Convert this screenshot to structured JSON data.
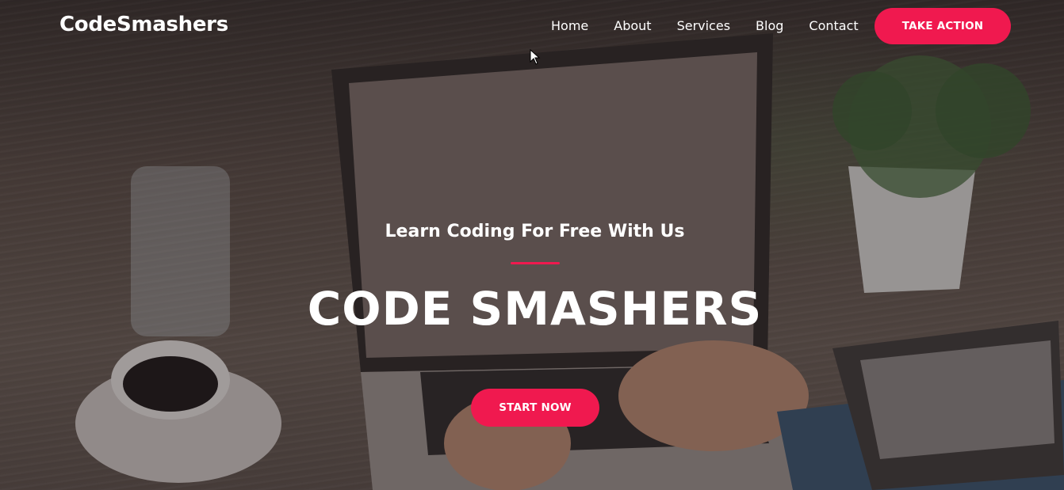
{
  "brand": {
    "name": "CodeSmashers"
  },
  "nav": {
    "items": [
      {
        "label": "Home"
      },
      {
        "label": "About"
      },
      {
        "label": "Services"
      },
      {
        "label": "Blog"
      },
      {
        "label": "Contact"
      }
    ],
    "cta_label": "TAKE ACTION"
  },
  "hero": {
    "subtitle": "Learn Coding For Free With Us",
    "title": "CODE SMASHERS",
    "cta_label": "START NOW"
  },
  "colors": {
    "accent": "#f0194f",
    "text": "#ffffff"
  }
}
